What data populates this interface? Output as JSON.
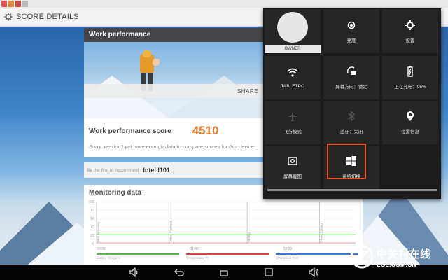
{
  "status_strip": {
    "icons": [
      "app-icon-a",
      "app-icon-b",
      "app-icon-c",
      "font-icon"
    ]
  },
  "header": {
    "title": "SCORE DETAILS",
    "icon": "gear-icon"
  },
  "work_performance": {
    "title": "Work performance",
    "share_label": "SHARE",
    "score_label": "Work performance score",
    "score_value": "4510",
    "score_note": "Sorry, we don't yet have enough data to compare scores for this device."
  },
  "recommend": {
    "text": "Be the first to recommend",
    "device": "Intel I101"
  },
  "monitoring": {
    "title": "Monitoring data"
  },
  "chart_data": {
    "type": "line",
    "ylim": [
      0,
      100
    ],
    "y_ticks": [
      "100",
      "80",
      "60",
      "40",
      "20",
      "0"
    ],
    "x_ticks": [
      "00:00",
      "01:40",
      "03:20"
    ],
    "section_labels": [
      "Web Browsing",
      "Video Playback",
      "Writing",
      "Photo Editing"
    ],
    "legend": [
      "Battery charge %",
      "Temperature °C",
      "CPU Clock GHz"
    ],
    "series": [
      {
        "name": "Battery charge %",
        "color": "#5fb04a",
        "x": [
          0,
          0.5,
          1.0,
          1.5,
          2.0,
          2.5,
          3.0,
          3.5,
          4.0,
          4.3
        ],
        "values": [
          21,
          21,
          21,
          21,
          21,
          21,
          21,
          21,
          21,
          21
        ]
      }
    ]
  },
  "quick_settings": {
    "owner_label": "OWNER",
    "tiles": [
      {
        "label": "亮度",
        "icon": "brightness-icon"
      },
      {
        "label": "设置",
        "icon": "gear-icon"
      },
      {
        "label": "TABLETPC",
        "icon": "wifi-icon"
      },
      {
        "label": "屏幕方向：锁定",
        "icon": "rotation-lock-icon"
      },
      {
        "label": "正在充电：95%",
        "icon": "battery-charging-icon"
      },
      {
        "label": "飞行模式",
        "icon": "airplane-icon"
      },
      {
        "label": "蓝牙：关闭",
        "icon": "bluetooth-icon"
      },
      {
        "label": "位置信息",
        "icon": "location-icon"
      },
      {
        "label": "屏幕截图",
        "icon": "screenshot-icon"
      },
      {
        "label": "系统切换",
        "icon": "windows-icon"
      }
    ]
  },
  "navbar": {
    "icons": [
      "volume-down-icon",
      "back-icon",
      "home-icon",
      "recents-icon",
      "volume-up-icon"
    ]
  },
  "watermark": {
    "cn": "中关村在线",
    "url": "ZOL.COM.CN"
  },
  "colors": {
    "accent_orange": "#e8792b",
    "highlight_red": "#e8532a",
    "panel_dark": "#1c1c1c"
  }
}
